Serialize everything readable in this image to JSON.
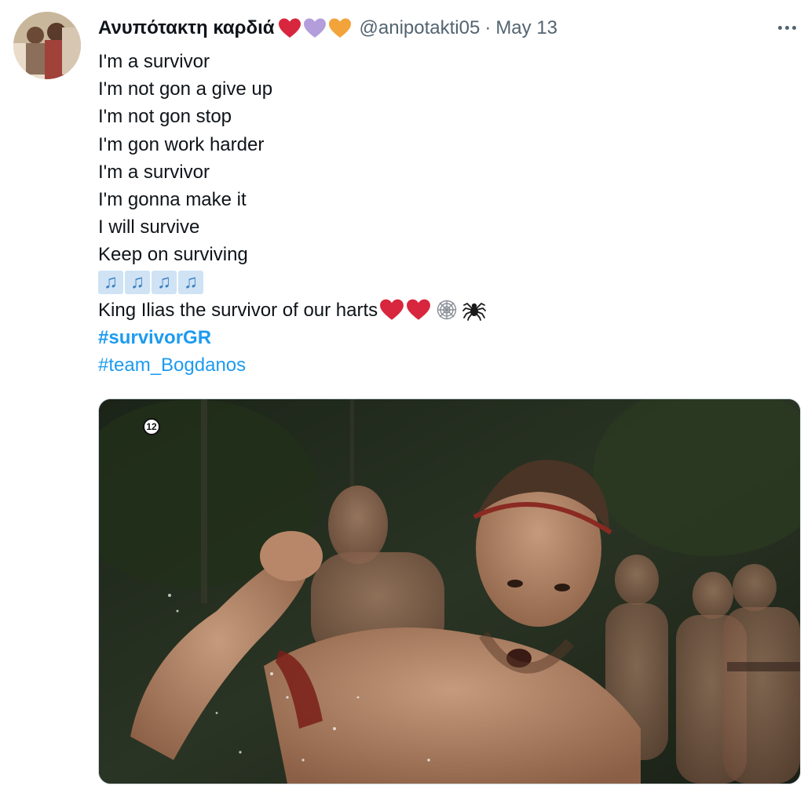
{
  "tweet": {
    "author": {
      "display_name": "Ανυπότακτη καρδιά",
      "name_emojis": [
        "red-heart",
        "purple-heart",
        "orange-heart"
      ],
      "handle": "@anipotakti05"
    },
    "separator": "·",
    "timestamp": "May 13",
    "lines": [
      "I'm a survivor",
      "I'm not gon a give up",
      "I'm not gon stop",
      "I'm gon work harder",
      "I'm a survivor",
      "I'm gonna make it",
      "I will survive",
      "Keep on surviving"
    ],
    "music_notes": [
      "♫",
      "♫",
      "♫",
      "♫"
    ],
    "closing_line": {
      "text": "King Ilias the survivor of our harts",
      "emojis": [
        "red-heart",
        "red-heart",
        "snowflake-web",
        "spider"
      ]
    },
    "hashtags": [
      {
        "text": "#survivorGR",
        "bold": true
      },
      {
        "text": "#team_Bogdanos",
        "bold": false
      }
    ],
    "media": {
      "age_rating": "12"
    }
  },
  "colors": {
    "link": "#1d9bf0",
    "secondary_text": "#536471",
    "primary_text": "#0f1419",
    "heart_red": "#d7263d",
    "heart_purple": "#b39ddb",
    "heart_orange": "#f2a33a"
  }
}
